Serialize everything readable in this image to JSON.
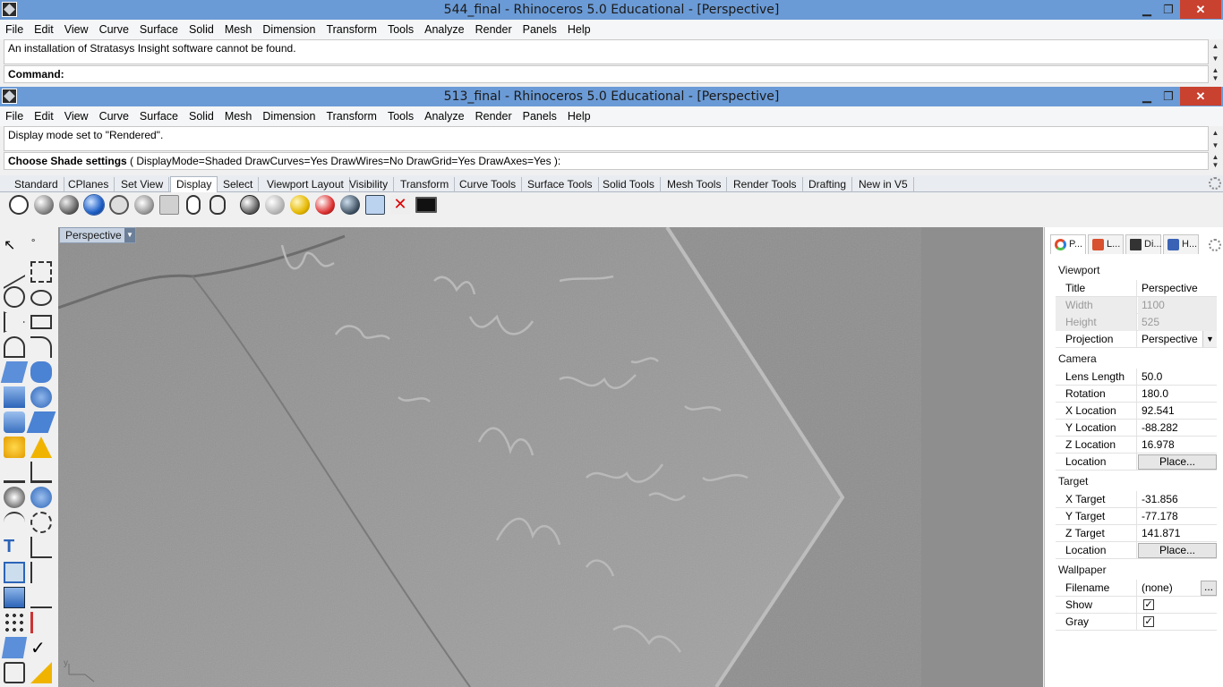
{
  "window1": {
    "title": "544_final - Rhinoceros 5.0 Educational - [Perspective]",
    "menu": [
      "File",
      "Edit",
      "View",
      "Curve",
      "Surface",
      "Solid",
      "Mesh",
      "Dimension",
      "Transform",
      "Tools",
      "Analyze",
      "Render",
      "Panels",
      "Help"
    ],
    "history": "An installation of Stratasys Insight software cannot be found.",
    "command_label": "Command:"
  },
  "window2": {
    "title": "513_final - Rhinoceros 5.0 Educational - [Perspective]",
    "menu": [
      "File",
      "Edit",
      "View",
      "Curve",
      "Surface",
      "Solid",
      "Mesh",
      "Dimension",
      "Transform",
      "Tools",
      "Analyze",
      "Render",
      "Panels",
      "Help"
    ],
    "history": "Display mode set to \"Rendered\".",
    "command_prefix": "Choose Shade settings",
    "command_options": "( DisplayMode=Shaded  DrawCurves=Yes  DrawWires=No  DrawGrid=Yes  DrawAxes=Yes ):"
  },
  "window_buttons": {
    "minimize": "▁",
    "restore": "❐",
    "close": "✕"
  },
  "toolbar_tabs": [
    "Standard",
    "CPlanes",
    "Set View",
    "Display",
    "Select",
    "Viewport Layout",
    "Visibility",
    "Transform",
    "Curve Tools",
    "Surface Tools",
    "Solid Tools",
    "Mesh Tools",
    "Render Tools",
    "Drafting",
    "New in V5"
  ],
  "active_tab": "Display",
  "viewport": {
    "label": "Perspective",
    "axis_label": "y"
  },
  "panel": {
    "tabs": [
      {
        "label": "P...",
        "icon": "properties-icon"
      },
      {
        "label": "L...",
        "icon": "layers-icon"
      },
      {
        "label": "Di...",
        "icon": "display-icon"
      },
      {
        "label": "H...",
        "icon": "help-icon"
      }
    ],
    "sections": {
      "viewport": "Viewport",
      "camera": "Camera",
      "target": "Target",
      "wallpaper": "Wallpaper"
    },
    "rows": {
      "title": {
        "label": "Title",
        "value": "Perspective"
      },
      "width": {
        "label": "Width",
        "value": "1100"
      },
      "height": {
        "label": "Height",
        "value": "525"
      },
      "projection": {
        "label": "Projection",
        "value": "Perspective"
      },
      "lens": {
        "label": "Lens Length",
        "value": "50.0"
      },
      "rotation": {
        "label": "Rotation",
        "value": "180.0"
      },
      "xloc": {
        "label": "X Location",
        "value": "92.541"
      },
      "yloc": {
        "label": "Y Location",
        "value": "-88.282"
      },
      "zloc": {
        "label": "Z Location",
        "value": "16.978"
      },
      "camloc": {
        "label": "Location",
        "button": "Place..."
      },
      "xt": {
        "label": "X Target",
        "value": "-31.856"
      },
      "yt": {
        "label": "Y Target",
        "value": "-77.178"
      },
      "zt": {
        "label": "Z Target",
        "value": "141.871"
      },
      "tloc": {
        "label": "Location",
        "button": "Place..."
      },
      "filename": {
        "label": "Filename",
        "value": "(none)",
        "button": "..."
      },
      "show": {
        "label": "Show",
        "checked": true
      },
      "gray": {
        "label": "Gray",
        "checked": true
      }
    }
  }
}
